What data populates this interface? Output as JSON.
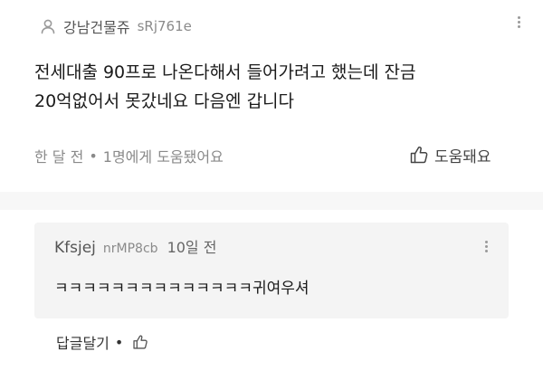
{
  "comment": {
    "author_name": "강남건물쥬",
    "author_id": "sRj761e",
    "text_line1": "전세대출 90프로 나온다해서 들어가려고 했는데 잔금",
    "text_line2": "20억없어서 못갔네요 다음엔 갑니다",
    "time": "한 달 전",
    "separator": "•",
    "helpful_count_text": "1명에게 도움됐어요",
    "helpful_button_label": "도움돼요",
    "icons": {
      "author": "person-icon",
      "more": "more-vertical-icon",
      "helpful": "thumbs-up-icon"
    }
  },
  "reply": {
    "author_name": "Kfsjej",
    "author_id": "nrMP8cb",
    "time": "10일 전",
    "text": "ㅋㅋㅋㅋㅋㅋㅋㅋㅋㅋㅋㅋㅋㅋ귀여우셔",
    "reply_link_label": "답글달기",
    "separator": "•",
    "icons": {
      "more": "more-vertical-icon",
      "like": "thumbs-up-icon"
    }
  },
  "colors": {
    "reply_bg": "#f4f4f4",
    "gap_bg": "#f7f7f7",
    "meta_text": "#8a8a8a"
  }
}
